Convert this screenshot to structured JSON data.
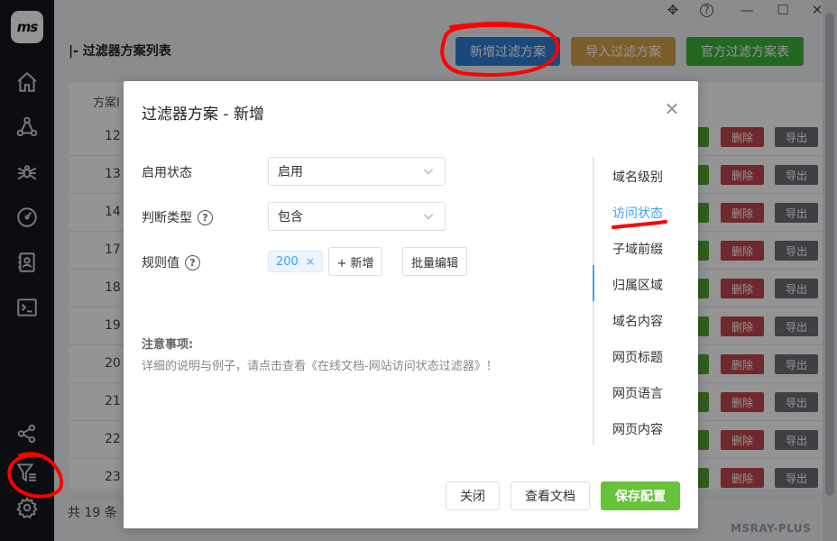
{
  "app": {
    "logo_text": "ms",
    "brand": "MSRAY-PLUS"
  },
  "window": {
    "move_glyph": "✥",
    "help_glyph": "?",
    "minimize_glyph": "—",
    "maximize_glyph": "☐",
    "close_glyph": "✕"
  },
  "page": {
    "title": "|- 过滤器方案列表",
    "buttons": {
      "add": "新增过滤方案",
      "import": "导入过滤方案",
      "official": "官方过滤方案表"
    },
    "table": {
      "id_header": "方案I",
      "rows": [
        {
          "id": "12"
        },
        {
          "id": "13"
        },
        {
          "id": "14"
        },
        {
          "id": "17"
        },
        {
          "id": "18"
        },
        {
          "id": "19"
        },
        {
          "id": "20"
        },
        {
          "id": "21"
        },
        {
          "id": "22"
        },
        {
          "id": "23"
        }
      ],
      "delete_label": "删除",
      "export_label": "导出"
    },
    "total": "共 19 条"
  },
  "modal": {
    "title": "过滤器方案 - 新增",
    "close_glyph": "×",
    "fields": {
      "status_label": "启用状态",
      "status_value": "启用",
      "type_label": "判断类型",
      "type_value": "包含",
      "rule_label": "规则值",
      "rule_tag": "200",
      "tag_close": "×",
      "add_button": "+ 新增",
      "batch_button": "批量编辑"
    },
    "notes": {
      "title": "注意事项:",
      "body": "详细的说明与例子，请点击查看《在线文档-网站访问状态过滤器》！"
    },
    "tabs": [
      "域名级别",
      "访问状态",
      "子域前缀",
      "归属区域",
      "域名内容",
      "网页标题",
      "网页语言",
      "网页内容"
    ],
    "active_tab": 1,
    "footer": {
      "close": "关闭",
      "docs": "查看文档",
      "save": "保存配置"
    }
  },
  "colors": {
    "primary": "#409eff",
    "add_button": "#2f7fd6",
    "import_button": "#d4a24a",
    "official_button": "#3db33a",
    "edit_button": "#52a532",
    "delete_button": "#c0464a",
    "export_button": "#6b6f75",
    "save_button": "#67c23a",
    "annotation": "#ff0000"
  }
}
